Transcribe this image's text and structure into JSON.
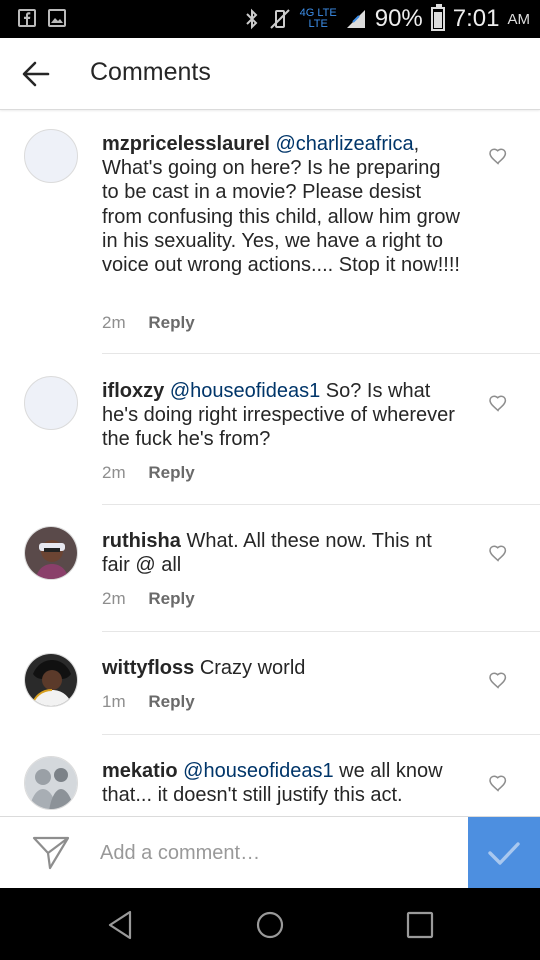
{
  "status_bar": {
    "network_top": "4G LTE",
    "network_bottom": "LTE",
    "battery": "90%",
    "time": "7:01",
    "ampm": "AM"
  },
  "header": {
    "title": "Comments"
  },
  "comments": [
    {
      "username": "mzpricelesslaurel",
      "mention": "@charlizeafrica",
      "text": ", What's going on here? Is he preparing to be cast in a movie? Please desist from confusing this child, allow him grow in his sexuality. Yes, we have a right to voice out wrong actions.... Stop it now!!!!",
      "time": "2m",
      "reply_label": "Reply"
    },
    {
      "username": "ifloxzy",
      "mention": "@houseofideas1",
      "text": " So? Is what he's doing right irrespective of wherever the fuck he's from?",
      "time": "2m",
      "reply_label": "Reply"
    },
    {
      "username": "ruthisha",
      "mention": "",
      "text": "What. All these now. This nt fair @ all",
      "time": "2m",
      "reply_label": "Reply"
    },
    {
      "username": "wittyfloss",
      "mention": "",
      "text": "Crazy world",
      "time": "1m",
      "reply_label": "Reply"
    },
    {
      "username": "mekatio",
      "mention": "@houseofideas1",
      "text": " we all know that... it doesn't still justify this act.",
      "time": "",
      "reply_label": ""
    }
  ],
  "add_comment": {
    "placeholder": "Add a comment…"
  },
  "colors": {
    "post_button": "#4d8fe0",
    "mention": "#003569"
  }
}
